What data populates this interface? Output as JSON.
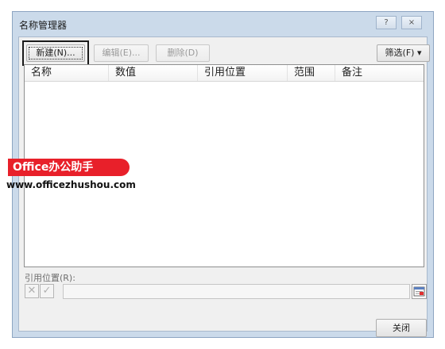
{
  "window": {
    "title": "名称管理器",
    "help_label": "?",
    "close_label": "×"
  },
  "toolbar": {
    "new_label": "新建(N)...",
    "edit_label": "编辑(E)...",
    "delete_label": "删除(D)",
    "filter_label": "筛选(F) ▾"
  },
  "list": {
    "columns": [
      "名称",
      "数值",
      "引用位置",
      "范围",
      "备注"
    ],
    "rows": []
  },
  "reference": {
    "label": "引用位置(R):",
    "cancel_glyph": "✕",
    "confirm_glyph": "✓",
    "value": ""
  },
  "footer": {
    "close_label": "关闭"
  },
  "watermark": {
    "badge": "Office办公助手",
    "url": "www.officezhushou.com"
  }
}
